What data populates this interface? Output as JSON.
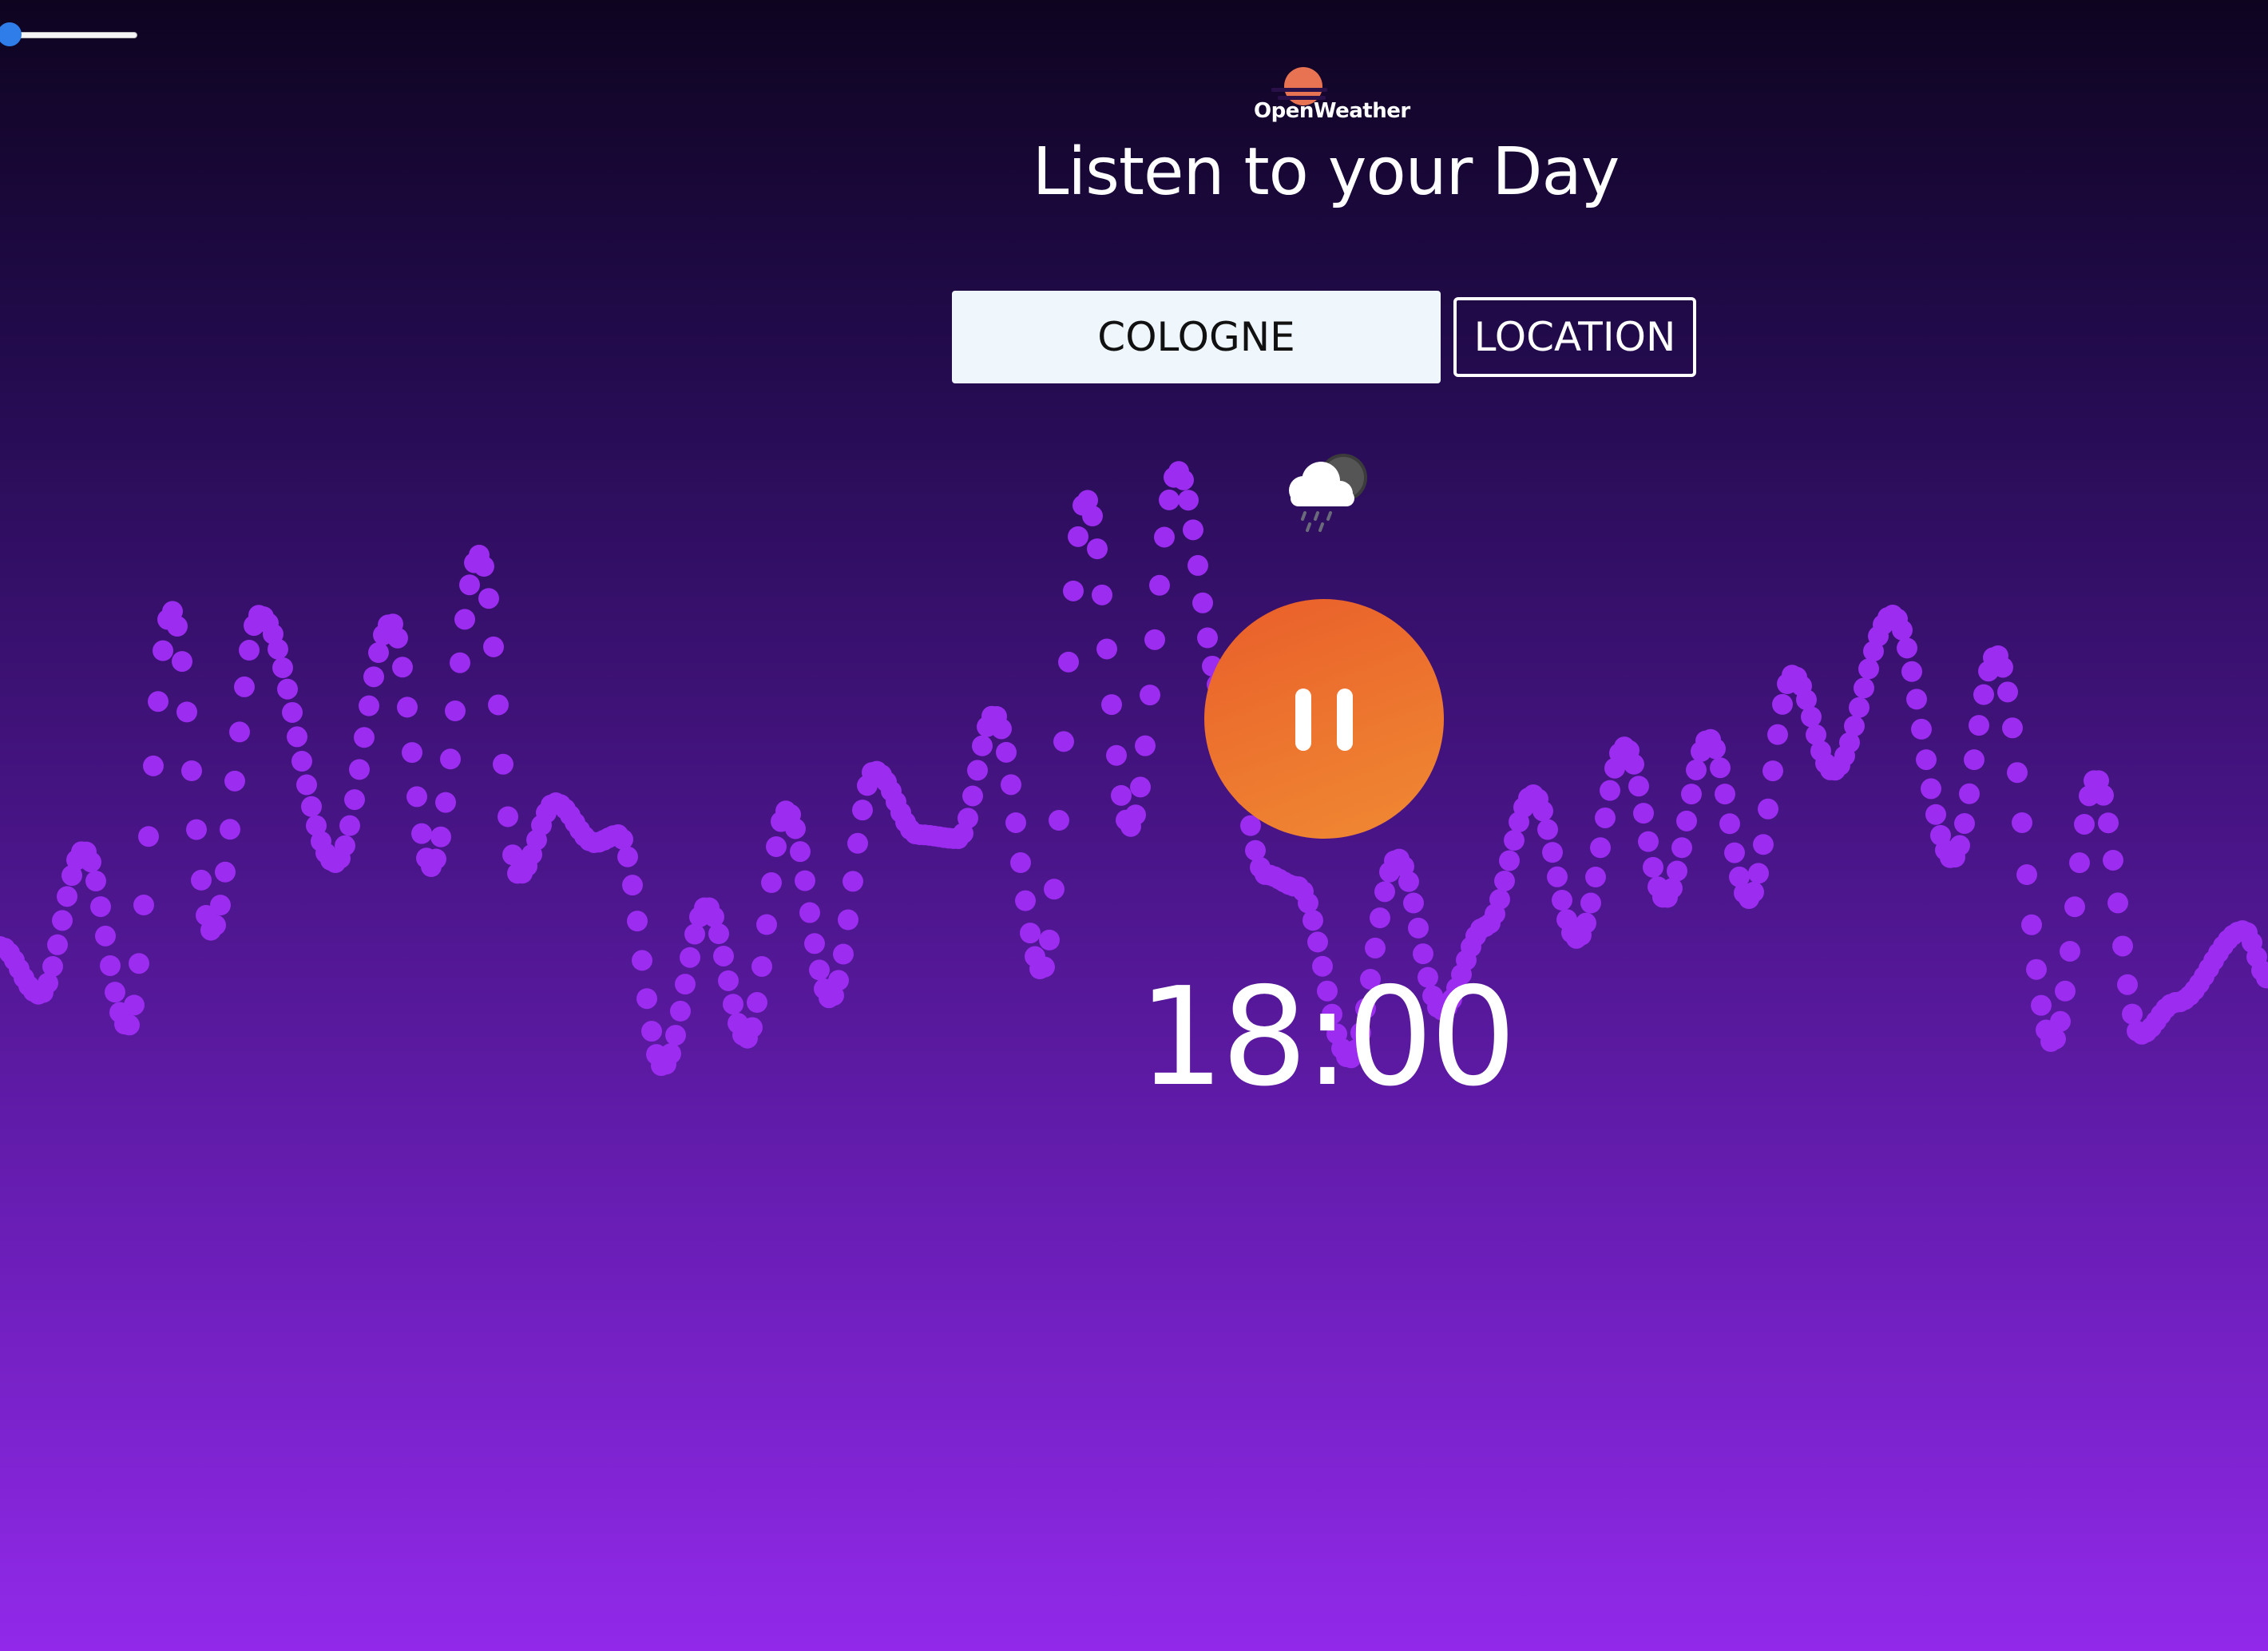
{
  "slider": {
    "value_fraction": 0.07
  },
  "brand": {
    "logo_text": "OpenWeather",
    "logo_color": "#e87352"
  },
  "header": {
    "title": "Listen to your Day"
  },
  "search": {
    "city_value": "COLOGNE",
    "location_button_label": "LOCATION"
  },
  "weather": {
    "icon": "cloud-rain-night-icon"
  },
  "player": {
    "state": "playing",
    "pause_icon": "pause-icon",
    "button_color": "#ee7530"
  },
  "time": {
    "display": "18:00"
  },
  "colors": {
    "wave": "#9b2cf0",
    "background_top": "#0e0420",
    "background_bottom": "#9229ea"
  }
}
